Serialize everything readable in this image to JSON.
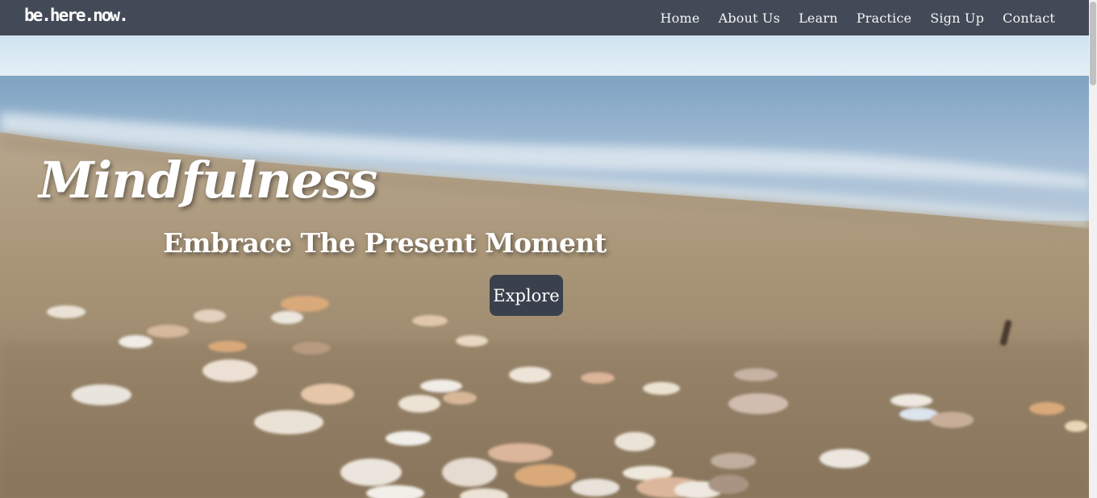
{
  "navbar": {
    "brand": "be.here.now.",
    "links": [
      "Home",
      "About Us",
      "Learn",
      "Practice",
      "Sign Up",
      "Contact"
    ],
    "background": "#434a57"
  },
  "hero": {
    "title": "Mindfulness",
    "subtitle": "Embrace The Present Moment",
    "button_label": "Explore",
    "image": "beach-with-seashells",
    "button_color": "#3a414d"
  }
}
